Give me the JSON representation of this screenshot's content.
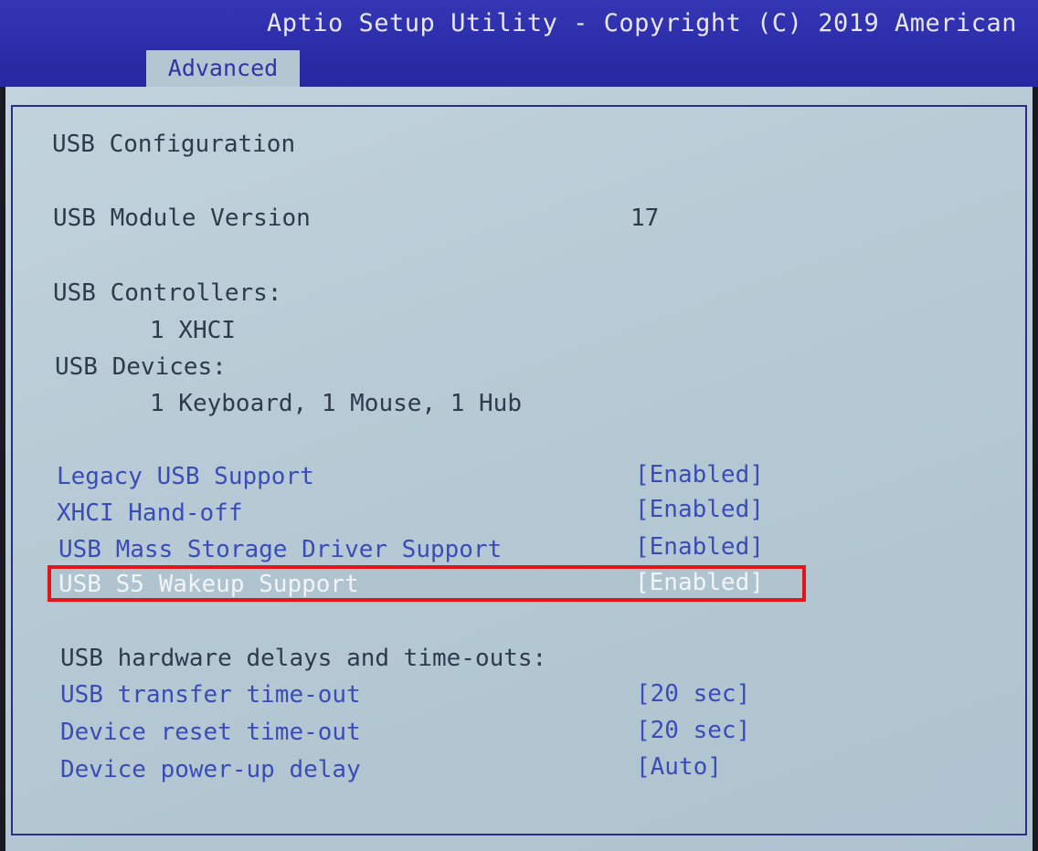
{
  "header": {
    "title": "Aptio Setup Utility - Copyright (C) 2019 American",
    "tab_active": "Advanced"
  },
  "section": {
    "title": "USB Configuration",
    "module_version_label": "USB Module Version",
    "module_version_value": "17",
    "controllers_label": "USB Controllers:",
    "controllers_value": "1 XHCI",
    "devices_label": "USB Devices:",
    "devices_value": "1 Keyboard, 1 Mouse, 1 Hub"
  },
  "settings": [
    {
      "label": "Legacy USB Support",
      "value": "[Enabled]"
    },
    {
      "label": "XHCI Hand-off",
      "value": "[Enabled]"
    },
    {
      "label": "USB Mass Storage Driver Support",
      "value": "[Enabled]"
    },
    {
      "label": "USB S5 Wakeup Support",
      "value": "[Enabled]",
      "selected": true
    }
  ],
  "delays": {
    "heading": "USB hardware delays and time-outs:",
    "items": [
      {
        "label": "USB transfer time-out",
        "value": "[20 sec]"
      },
      {
        "label": "Device reset time-out",
        "value": "[20 sec]"
      },
      {
        "label": "Device power-up delay",
        "value": "[Auto]"
      }
    ]
  },
  "colors": {
    "header_bg": "#2a2ca8",
    "panel_bg": "#b6c9d4",
    "option_text": "#3a4cb8",
    "static_text": "#2f3a4c",
    "selected_text": "#f2f5f8",
    "highlight_box": "#e0161a"
  }
}
